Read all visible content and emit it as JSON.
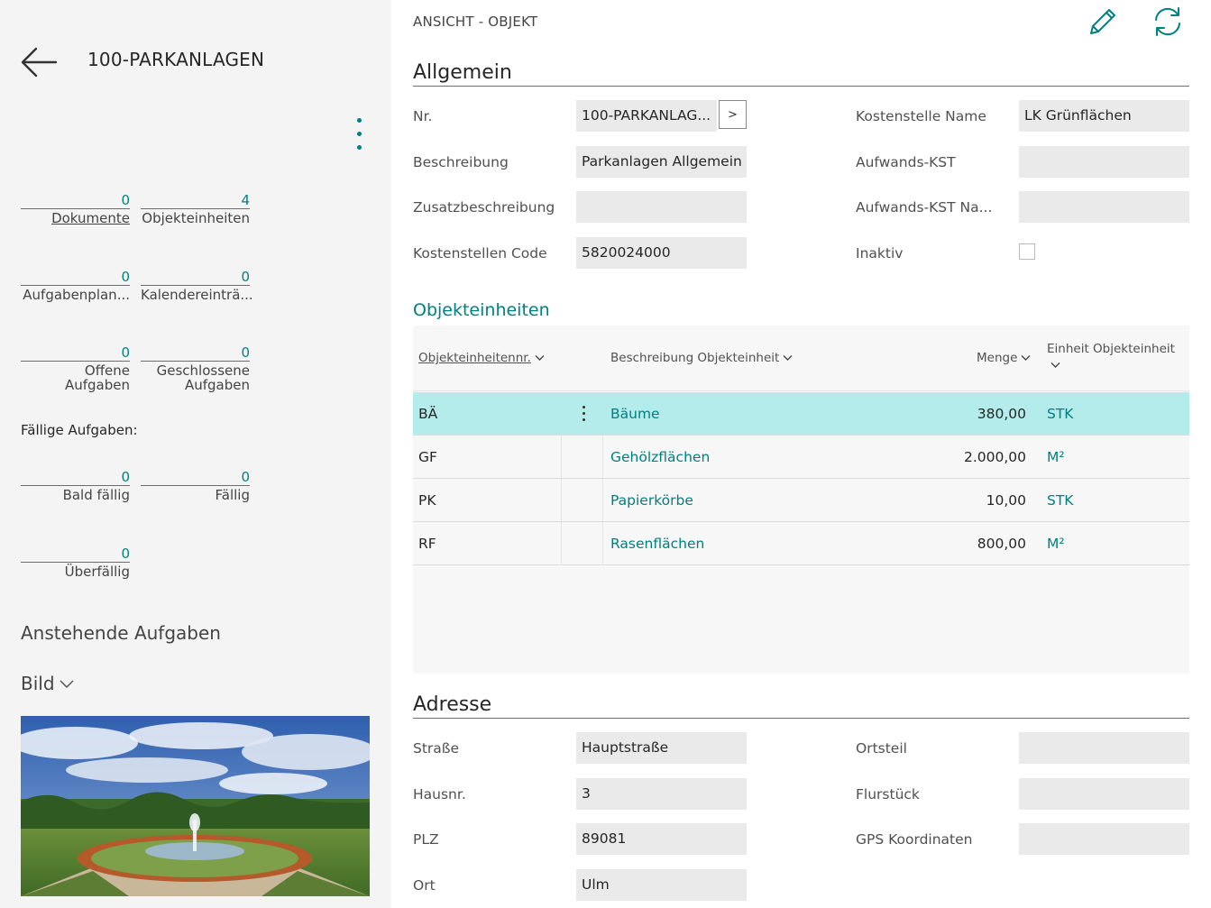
{
  "header": {
    "title": "100-PARKANLAGEN"
  },
  "breadcrumb": "ANSICHT - OBJEKT",
  "tiles": [
    {
      "value": "0",
      "label": "Dokumente"
    },
    {
      "value": "4",
      "label": "Objekteinheiten"
    },
    {
      "value": "0",
      "label": "Aufgabenplan..."
    },
    {
      "value": "0",
      "label": "Kalendereinträ..."
    },
    {
      "value": "0",
      "label_line1": "Offene",
      "label_line2": "Aufgaben"
    },
    {
      "value": "0",
      "label_line1": "Geschlossene",
      "label_line2": "Aufgaben"
    },
    {
      "value": "0",
      "label": "Bald fällig"
    },
    {
      "value": "0",
      "label": "Fällig"
    },
    {
      "value": "0",
      "label": "Überfällig"
    }
  ],
  "due_heading": "Fällige Aufgaben:",
  "pending_heading": "Anstehende Aufgaben",
  "picture_heading": "Bild",
  "general": {
    "title": "Allgemein",
    "fields": {
      "nr": {
        "label": "Nr.",
        "value": "100-PARKANLAG..."
      },
      "beschreibung": {
        "label": "Beschreibung",
        "value": "Parkanlagen Allgemein"
      },
      "zusatz": {
        "label": "Zusatzbeschreibung",
        "value": ""
      },
      "kst_code": {
        "label": "Kostenstellen Code",
        "value": "5820024000"
      },
      "kst_name": {
        "label": "Kostenstelle Name",
        "value": "LK Grünflächen"
      },
      "aufwands_kst": {
        "label": "Aufwands-KST",
        "value": ""
      },
      "aufwands_kst_name": {
        "label": "Aufwands-KST Na...",
        "value": ""
      },
      "inaktiv": {
        "label": "Inaktiv",
        "checked": false
      }
    },
    "lookup_label": ">"
  },
  "units": {
    "title": "Objekteinheiten",
    "columns": {
      "nr": "Objekteinheitennr.",
      "desc": "Beschreibung Objekteinheit",
      "qty": "Menge",
      "unit": "Einheit Objekteinheit"
    },
    "rows": [
      {
        "nr": "BÄ",
        "desc": "Bäume",
        "qty": "380,00",
        "unit": "STK",
        "selected": true
      },
      {
        "nr": "GF",
        "desc": "Gehölzflächen",
        "qty": "2.000,00",
        "unit": "M²",
        "selected": false
      },
      {
        "nr": "PK",
        "desc": "Papierkörbe",
        "qty": "10,00",
        "unit": "STK",
        "selected": false
      },
      {
        "nr": "RF",
        "desc": "Rasenflächen",
        "qty": "800,00",
        "unit": "M²",
        "selected": false
      }
    ]
  },
  "address": {
    "title": "Adresse",
    "fields": {
      "strasse": {
        "label": "Straße",
        "value": "Hauptstraße"
      },
      "hausnr": {
        "label": "Hausnr.",
        "value": "3"
      },
      "plz": {
        "label": "PLZ",
        "value": "89081"
      },
      "ort": {
        "label": "Ort",
        "value": "Ulm"
      },
      "ortsteil": {
        "label": "Ortsteil",
        "value": ""
      },
      "flurstueck": {
        "label": "Flurstück",
        "value": ""
      },
      "gps": {
        "label": "GPS Koordinaten",
        "value": ""
      }
    }
  },
  "colors": {
    "accent": "#00807f",
    "selected_row": "#b3ecea",
    "field_bg": "#eaeaea",
    "panel_bg": "#f4f4f4"
  },
  "icons": [
    "back-arrow-icon",
    "more-vertical-icon",
    "edit-pencil-icon",
    "refresh-icon",
    "chevron-down-icon",
    "row-menu-icon"
  ]
}
